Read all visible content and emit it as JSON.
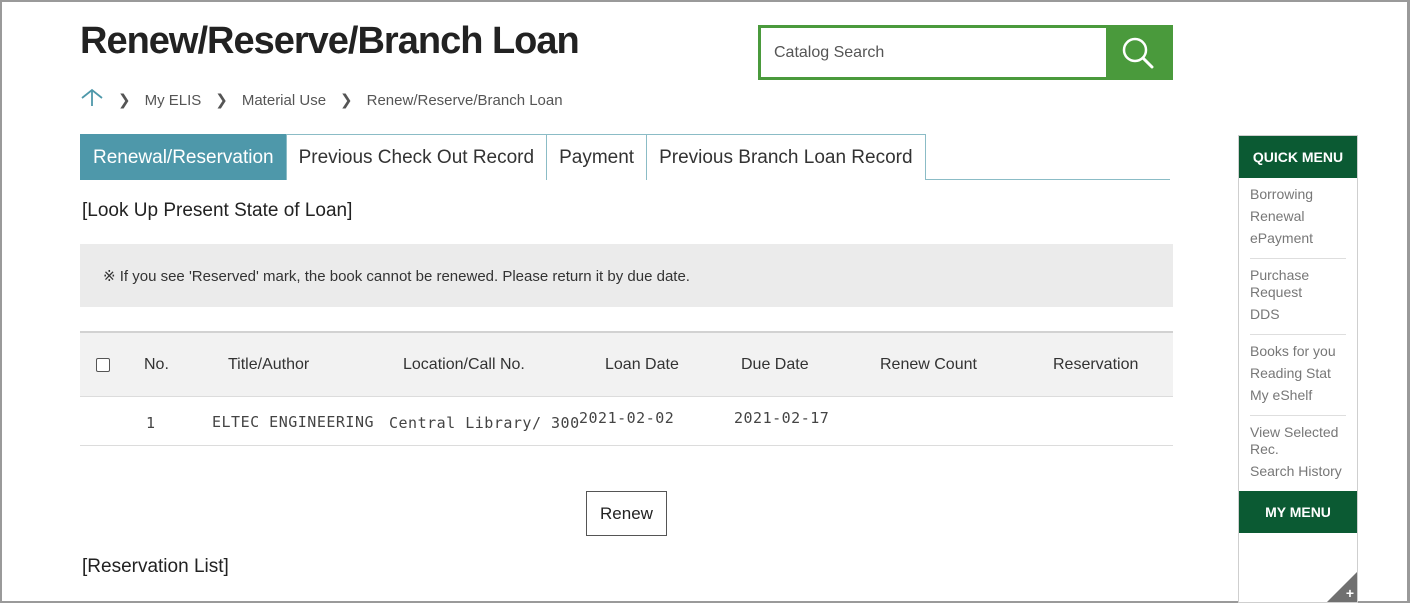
{
  "page": {
    "title": "Renew/Reserve/Branch Loan"
  },
  "search": {
    "placeholder": "Catalog Search"
  },
  "breadcrumb": [
    "My ELIS",
    "Material Use",
    "Renew/Reserve/Branch Loan"
  ],
  "tabs": [
    {
      "label": "Renewal/Reservation",
      "active": true
    },
    {
      "label": "Previous Check Out Record",
      "active": false
    },
    {
      "label": "Payment",
      "active": false
    },
    {
      "label": "Previous Branch Loan Record",
      "active": false
    }
  ],
  "loan_section": {
    "title": "[Look Up Present State of Loan]",
    "notice": "※ If you see 'Reserved' mark, the book cannot be renewed. Please return it by due date."
  },
  "table": {
    "headers": [
      "No.",
      "Title/Author",
      "Location/Call No.",
      "Loan Date",
      "Due Date",
      "Renew Count",
      "Reservation"
    ],
    "rows": [
      {
        "no": "1",
        "title": "ELTEC ENGINEERING",
        "location": "Central Library/ 300",
        "loan_date": "2021-02-02",
        "due_date": "2021-02-17",
        "renew_count": "",
        "reservation": ""
      }
    ]
  },
  "renew_button": {
    "label": "Renew"
  },
  "reservation_section": {
    "title": "[Reservation List]"
  },
  "quick_menu": {
    "title": "QUICK MENU",
    "groups": [
      [
        "Borrowing",
        "Renewal",
        "ePayment"
      ],
      [
        "Purchase Request",
        "DDS"
      ],
      [
        "Books for you",
        "Reading Stat",
        "My eShelf"
      ],
      [
        "View Selected Rec.",
        "Search History"
      ]
    ],
    "my_menu": "MY MENU"
  },
  "colors": {
    "accent_green": "#4a9a3c",
    "tab_active": "#4e98aa",
    "quick_green": "#0b5a33"
  },
  "icons": {
    "search": "magnifier-icon",
    "home": "home-icon",
    "separator": "chevron-right-icon",
    "corner": "plus-icon"
  }
}
